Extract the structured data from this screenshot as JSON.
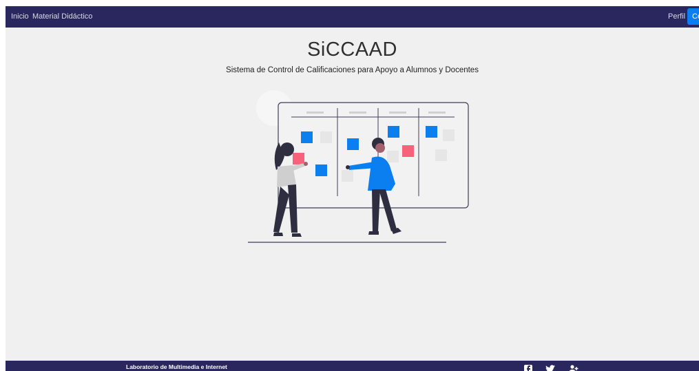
{
  "nav": {
    "inicio": "Inicio",
    "material": "Material Didáctico",
    "perfil": "Perfil",
    "button_label": "Cerrar sesión"
  },
  "hero": {
    "title": "SiCCAAD",
    "subtitle": "Sistema de Control de Calificaciones para Apoyo a Alumnos y Docentes"
  },
  "footer": {
    "text": "Laboratorio de Multimedia e Internet",
    "social_icons": [
      "facebook-icon",
      "twitter-icon",
      "social-icon"
    ]
  },
  "colors": {
    "navbar": "#29275e",
    "background": "#f0f0f0",
    "accent_blue": "#0b7ef0",
    "accent_pink": "#f7627a"
  }
}
